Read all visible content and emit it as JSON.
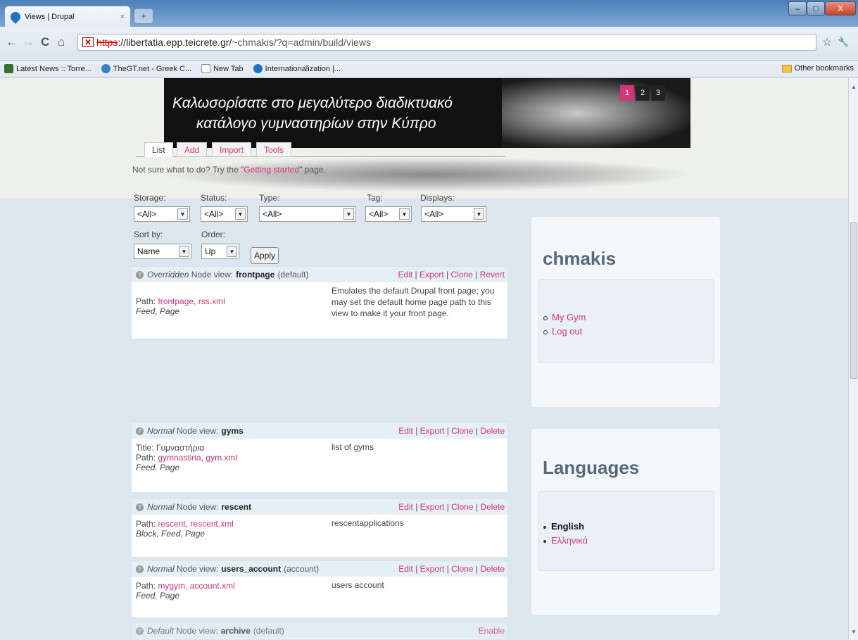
{
  "browser": {
    "tab_title": "Views | Drupal",
    "tab_close": "×",
    "new_tab": "+",
    "url_scheme": "https",
    "url_host": "://libertatia.epp.teicrete.gr/",
    "url_path": "~chmakis/?q=admin/build/views",
    "back": "←",
    "forward": "→",
    "reload": "C",
    "home": "⌂",
    "star": "☆",
    "wrench": "🔧",
    "win_min": "–",
    "win_max": "□",
    "win_close": "X",
    "bookmarks": [
      {
        "label": "Latest News :: Torre...",
        "icon_color": "#3a6e2c"
      },
      {
        "label": "TheGT.net - Greek C...",
        "icon_color": "#3a7fc1"
      },
      {
        "label": "New Tab",
        "icon_color": "#ffffff"
      },
      {
        "label": "Internationalization |...",
        "icon_color": "#1f74c2"
      }
    ],
    "other_bookmarks": "Other bookmarks"
  },
  "banner": {
    "line1": "Καλωσορίσατε στο μεγαλύτερο διαδικτυακό",
    "line2": "κατάλογο γυμναστηρίων στην Κύπρο",
    "pager": [
      "1",
      "2",
      "3"
    ],
    "pager_active": "1"
  },
  "tabs": [
    {
      "label": "List",
      "active": true
    },
    {
      "label": "Add",
      "active": false
    },
    {
      "label": "Import",
      "active": false
    },
    {
      "label": "Tools",
      "active": false
    }
  ],
  "hint": {
    "prefix": "Not sure what to do? Try the \"",
    "link": "Getting started",
    "suffix": "\" page."
  },
  "filters": {
    "storage": {
      "label": "Storage:",
      "value": "<All>"
    },
    "status": {
      "label": "Status:",
      "value": "<All>"
    },
    "type": {
      "label": "Type:",
      "value": "<All>"
    },
    "tag": {
      "label": "Tag:",
      "value": "<All>"
    },
    "displays": {
      "label": "Displays:",
      "value": "<All>"
    },
    "sort_by": {
      "label": "Sort by:",
      "value": "Name"
    },
    "order": {
      "label": "Order:",
      "value": "Up"
    },
    "apply": "Apply"
  },
  "views": [
    {
      "status": "Overridden",
      "kind": "Node view:",
      "name": "frontpage",
      "tag": "(default)",
      "ops": [
        "Edit",
        "Export",
        "Clone",
        "Revert"
      ],
      "title": "",
      "path_label": "Path:",
      "paths": "frontpage, rss.xml",
      "displays": "Feed, Page",
      "description": "Emulates the default Drupal front page; you may set the default home page path to this view to make it your front page."
    },
    {
      "status": "Normal",
      "kind": "Node view:",
      "name": "gyms",
      "tag": "",
      "ops": [
        "Edit",
        "Export",
        "Clone",
        "Delete"
      ],
      "title": "Title: Γυμναστήρια",
      "path_label": "Path:",
      "paths": "gymnastiria, gym.xml",
      "displays": "Feed, Page",
      "description": "list of gyms"
    },
    {
      "status": "Normal",
      "kind": "Node view:",
      "name": "rescent",
      "tag": "",
      "ops": [
        "Edit",
        "Export",
        "Clone",
        "Delete"
      ],
      "title": "",
      "path_label": "Path:",
      "paths": "rescent, rescent.xml",
      "displays": "Block, Feed, Page",
      "description": "rescentapplications"
    },
    {
      "status": "Normal",
      "kind": "Node view:",
      "name": "users_account",
      "tag": "(account)",
      "ops": [
        "Edit",
        "Export",
        "Clone",
        "Delete"
      ],
      "title": "",
      "path_label": "Path:",
      "paths": "mygym, account.xml",
      "displays": "Feed, Page",
      "description": "users account"
    },
    {
      "status": "Default",
      "kind": "Node view:",
      "name": "archive",
      "tag": "(default)",
      "ops": [
        "Enable"
      ],
      "title": "",
      "path_label": "",
      "paths": "",
      "displays": "",
      "description": ""
    }
  ],
  "sidebar": {
    "user_block": {
      "title": "chmakis",
      "links": [
        "My Gym",
        "Log out"
      ]
    },
    "languages_block": {
      "title": "Languages",
      "current": "English",
      "other": "Ελληνικά"
    }
  },
  "colors": {
    "link": "#d4347a",
    "accent_block": "#e9f1f6"
  }
}
